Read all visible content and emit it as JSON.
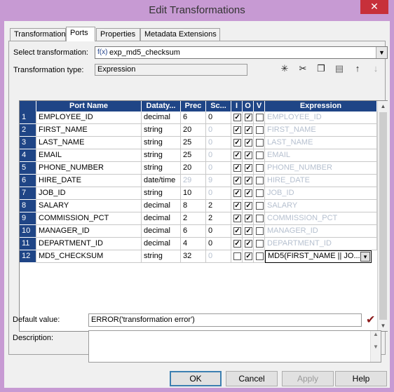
{
  "window": {
    "title": "Edit Transformations",
    "close_glyph": "✕"
  },
  "tabs": [
    {
      "label": "Transformation"
    },
    {
      "label": "Ports"
    },
    {
      "label": "Properties"
    },
    {
      "label": "Metadata Extensions"
    }
  ],
  "select_transformation": {
    "label": "Select transformation:",
    "value": "exp_md5_checksum",
    "icon": "f(x)"
  },
  "transformation_type": {
    "label": "Transformation type:",
    "value": "Expression"
  },
  "toolbar_icons": [
    "new-port-icon",
    "cut-icon",
    "copy-icon",
    "paste-icon",
    "move-up-icon",
    "move-down-icon"
  ],
  "grid": {
    "columns": [
      "Port Name",
      "Datatype",
      "Prec",
      "Sc...",
      "I",
      "O",
      "V",
      "Expression"
    ],
    "columns_display": [
      "Port Name",
      "Dataty...",
      "Prec",
      "Sc...",
      "I",
      "O",
      "V",
      "Expression"
    ],
    "rows": [
      {
        "num": "1",
        "name": "EMPLOYEE_ID",
        "type": "decimal",
        "prec": "6",
        "scale": "0",
        "scale_dim": false,
        "prec_dim": false,
        "i": true,
        "o": true,
        "v": false,
        "expr": "EMPLOYEE_ID"
      },
      {
        "num": "2",
        "name": "FIRST_NAME",
        "type": "string",
        "prec": "20",
        "scale": "0",
        "scale_dim": true,
        "prec_dim": false,
        "i": true,
        "o": true,
        "v": false,
        "expr": "FIRST_NAME"
      },
      {
        "num": "3",
        "name": "LAST_NAME",
        "type": "string",
        "prec": "25",
        "scale": "0",
        "scale_dim": true,
        "prec_dim": false,
        "i": true,
        "o": true,
        "v": false,
        "expr": "LAST_NAME"
      },
      {
        "num": "4",
        "name": "EMAIL",
        "type": "string",
        "prec": "25",
        "scale": "0",
        "scale_dim": true,
        "prec_dim": false,
        "i": true,
        "o": true,
        "v": false,
        "expr": "EMAIL"
      },
      {
        "num": "5",
        "name": "PHONE_NUMBER",
        "type": "string",
        "prec": "20",
        "scale": "0",
        "scale_dim": true,
        "prec_dim": false,
        "i": true,
        "o": true,
        "v": false,
        "expr": "PHONE_NUMBER"
      },
      {
        "num": "6",
        "name": "HIRE_DATE",
        "type": "date/time",
        "prec": "29",
        "scale": "9",
        "scale_dim": true,
        "prec_dim": true,
        "i": true,
        "o": true,
        "v": false,
        "expr": "HIRE_DATE"
      },
      {
        "num": "7",
        "name": "JOB_ID",
        "type": "string",
        "prec": "10",
        "scale": "0",
        "scale_dim": true,
        "prec_dim": false,
        "i": true,
        "o": true,
        "v": false,
        "expr": "JOB_ID"
      },
      {
        "num": "8",
        "name": "SALARY",
        "type": "decimal",
        "prec": "8",
        "scale": "2",
        "scale_dim": false,
        "prec_dim": false,
        "i": true,
        "o": true,
        "v": false,
        "expr": "SALARY"
      },
      {
        "num": "9",
        "name": "COMMISSION_PCT",
        "type": "decimal",
        "prec": "2",
        "scale": "2",
        "scale_dim": false,
        "prec_dim": false,
        "i": true,
        "o": true,
        "v": false,
        "expr": "COMMISSION_PCT"
      },
      {
        "num": "10",
        "name": "MANAGER_ID",
        "type": "decimal",
        "prec": "6",
        "scale": "0",
        "scale_dim": false,
        "prec_dim": false,
        "i": true,
        "o": true,
        "v": false,
        "expr": "MANAGER_ID"
      },
      {
        "num": "11",
        "name": "DEPARTMENT_ID",
        "type": "decimal",
        "prec": "4",
        "scale": "0",
        "scale_dim": false,
        "prec_dim": false,
        "i": true,
        "o": true,
        "v": false,
        "expr": "DEPARTMENT_ID"
      },
      {
        "num": "12",
        "name": "MD5_CHECKSUM",
        "type": "string",
        "prec": "32",
        "scale": "0",
        "scale_dim": true,
        "prec_dim": false,
        "i": false,
        "o": true,
        "v": false,
        "expr": "MD5(FIRST_NAME || JO...",
        "editing": true
      }
    ]
  },
  "default_value": {
    "label": "Default value:",
    "value": "ERROR('transformation error')"
  },
  "description": {
    "label": "Description:",
    "value": ""
  },
  "buttons": {
    "ok": "OK",
    "cancel": "Cancel",
    "apply": "Apply",
    "help": "Help"
  }
}
